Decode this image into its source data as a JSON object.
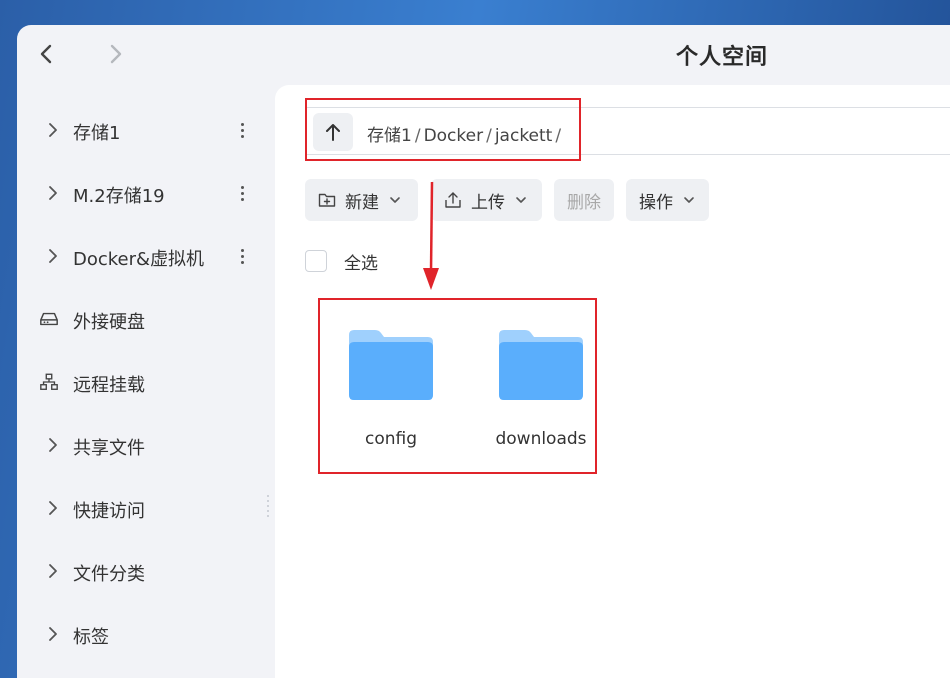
{
  "window": {
    "title": "个人空间",
    "back_icon": "chevron-left-icon",
    "forward_icon": "chevron-right-icon"
  },
  "sidebar": {
    "items": [
      {
        "label": "存储1",
        "lead_icon": "chevron-right-icon",
        "has_more": true
      },
      {
        "label": "M.2存储19",
        "lead_icon": "chevron-right-icon",
        "has_more": true
      },
      {
        "label": "Docker&虚拟机",
        "lead_icon": "chevron-right-icon",
        "has_more": true
      },
      {
        "label": "外接硬盘",
        "lead_icon": "external-drive-icon",
        "has_more": false
      },
      {
        "label": "远程挂载",
        "lead_icon": "network-icon",
        "has_more": false
      },
      {
        "label": "共享文件",
        "lead_icon": "chevron-right-icon",
        "has_more": false
      },
      {
        "label": "快捷访问",
        "lead_icon": "chevron-right-icon",
        "has_more": false
      },
      {
        "label": "文件分类",
        "lead_icon": "chevron-right-icon",
        "has_more": false
      },
      {
        "label": "标签",
        "lead_icon": "chevron-right-icon",
        "has_more": false
      }
    ]
  },
  "path": {
    "up_icon": "arrow-up-icon",
    "crumbs": [
      "存储1",
      "Docker",
      "jackett"
    ],
    "separator": "/"
  },
  "toolbar": {
    "new_label": "新建",
    "upload_label": "上传",
    "delete_label": "删除",
    "actions_label": "操作"
  },
  "select_all_label": "全选",
  "files": [
    {
      "name": "config",
      "icon": "folder-icon"
    },
    {
      "name": "downloads",
      "icon": "folder-icon"
    }
  ],
  "colors": {
    "annotation": "#e0242a",
    "folder_front": "#5aaefc",
    "folder_back": "#9fd0fd",
    "window_bg": "#f2f3f7"
  }
}
